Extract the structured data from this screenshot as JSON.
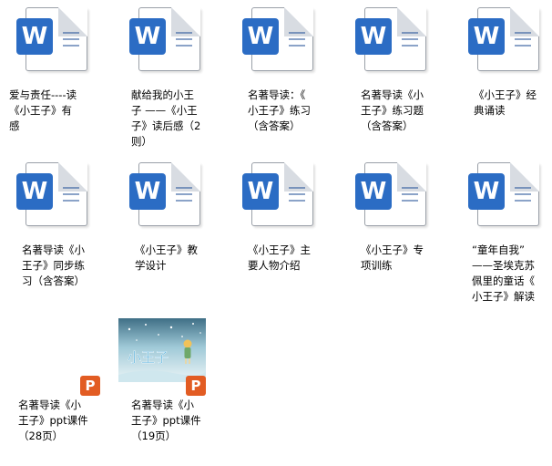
{
  "files": [
    {
      "label": "爱与责任----读\n《小王子》有\n感",
      "type": "word",
      "icon": "word-doc-icon"
    },
    {
      "label": "献给我的小王\n子 ——《小王\n子》读后感（2\n则）",
      "type": "word",
      "icon": "word-doc-icon"
    },
    {
      "label": "名著导读：《\n小王子》练习\n（含答案）",
      "type": "word",
      "icon": "word-doc-icon"
    },
    {
      "label": "名著导读《小\n王子》练习题\n（含答案）",
      "type": "word",
      "icon": "word-doc-icon"
    },
    {
      "label": "《小王子》经\n典诵读",
      "type": "word",
      "icon": "word-doc-icon"
    },
    {
      "label": "名著导读《小\n王子》同步练\n习（含答案）",
      "type": "word",
      "icon": "word-doc-icon"
    },
    {
      "label": "《小王子》教\n学设计",
      "type": "word",
      "icon": "word-doc-icon"
    },
    {
      "label": "《小王子》主\n要人物介绍",
      "type": "word",
      "icon": "word-doc-icon"
    },
    {
      "label": "《小王子》专\n项训练",
      "type": "word",
      "icon": "word-doc-icon"
    },
    {
      "label": "“童年自我”\n——圣埃克苏\n佩里的童话《\n小王子》解读",
      "type": "word",
      "icon": "word-doc-icon"
    },
    {
      "label": "名著导读《小\n王子》ppt课件\n（28页）",
      "type": "ppt",
      "icon": "powerpoint-icon"
    },
    {
      "label": "名著导读《小\n王子》ppt课件\n（19页）",
      "type": "ppt-thumb",
      "icon": "powerpoint-icon",
      "thumb_text": "小王子"
    }
  ],
  "badges": {
    "word": "W",
    "ppt": "P"
  },
  "colors": {
    "word": "#2b6cc4",
    "ppt": "#e25c23"
  }
}
